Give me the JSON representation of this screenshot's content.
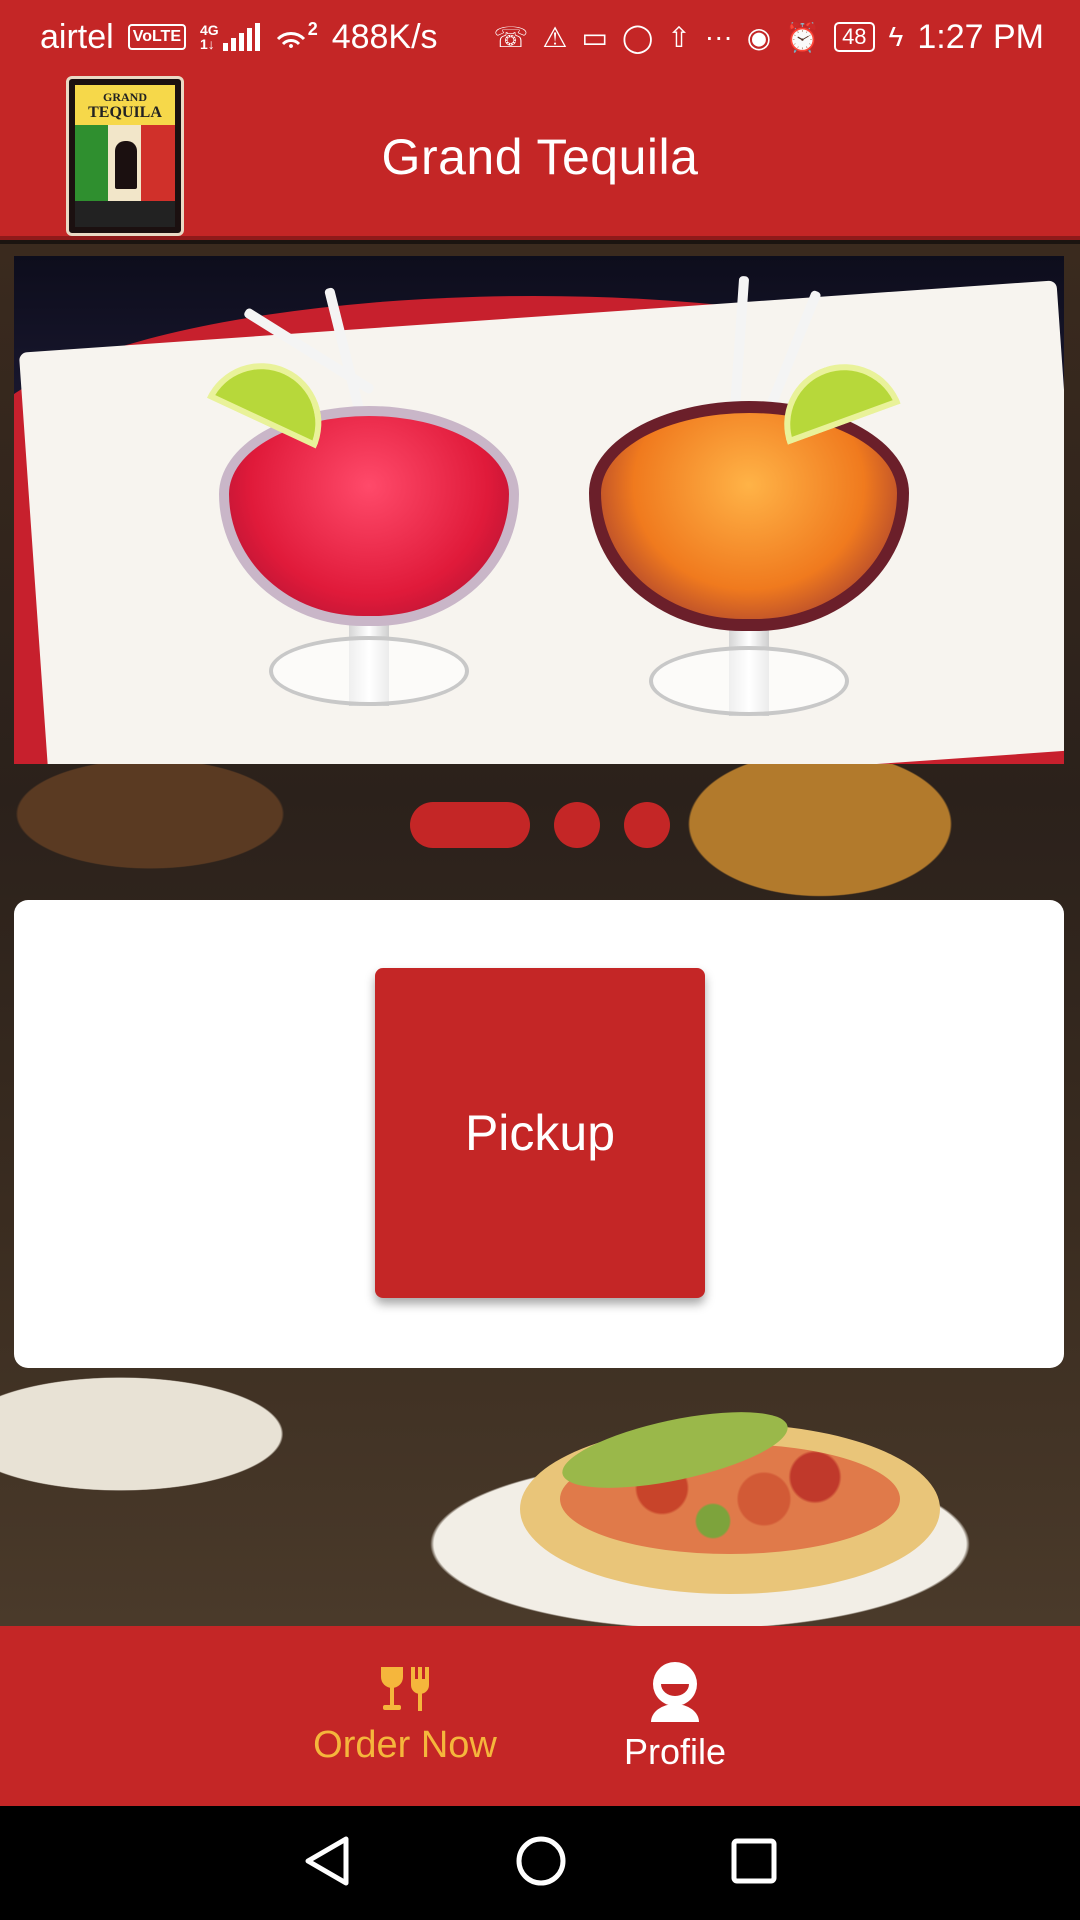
{
  "status_bar": {
    "carrier": "airtel",
    "volte": "VoLTE",
    "network": "4G",
    "network_sub": "1↓",
    "hotspot_sup": "2",
    "speed": "488K/s",
    "more": "···",
    "battery": "48",
    "time": "1:27 PM"
  },
  "header": {
    "title": "Grand Tequila",
    "logo": {
      "line1": "GRAND",
      "line2": "TEQUILA"
    }
  },
  "carousel": {
    "slide_count": 3,
    "active_index": 0
  },
  "card": {
    "pickup_label": "Pickup"
  },
  "bottom_nav": {
    "items": [
      {
        "label": "Order Now",
        "icon": "dining-icon",
        "color": "#f5b63c"
      },
      {
        "label": "Profile",
        "icon": "person-icon",
        "color": "#ffffff"
      }
    ]
  },
  "colors": {
    "primary": "#c42626",
    "accent": "#f5b63c"
  }
}
